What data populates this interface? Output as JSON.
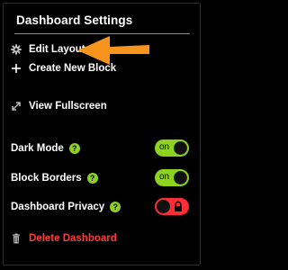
{
  "panel": {
    "title": "Dashboard Settings"
  },
  "menu": {
    "edit_layout": {
      "label": "Edit Layout",
      "icon": "gear-icon"
    },
    "create_block": {
      "label": "Create New Block",
      "icon": "plus-icon"
    },
    "view_fullscreen": {
      "label": "View Fullscreen",
      "icon": "expand-icon"
    },
    "delete_dashboard": {
      "label": "Delete Dashboard",
      "icon": "trash-icon"
    }
  },
  "toggles": [
    {
      "label": "Dark Mode",
      "help": "?",
      "state": "on",
      "state_label": "on"
    },
    {
      "label": "Block Borders",
      "help": "?",
      "state": "on",
      "state_label": "on"
    },
    {
      "label": "Dashboard Privacy",
      "help": "?",
      "state": "off",
      "icon": "lock-icon"
    }
  ],
  "colors": {
    "background": "#000000",
    "accent_green": "#8dd21f",
    "danger_red": "#ff3b3b",
    "toggle_red": "#ff2d35",
    "arrow_orange": "#f7941d",
    "divider": "#8a8a8a"
  },
  "annotation": {
    "icon": "orange-arrow-icon"
  }
}
